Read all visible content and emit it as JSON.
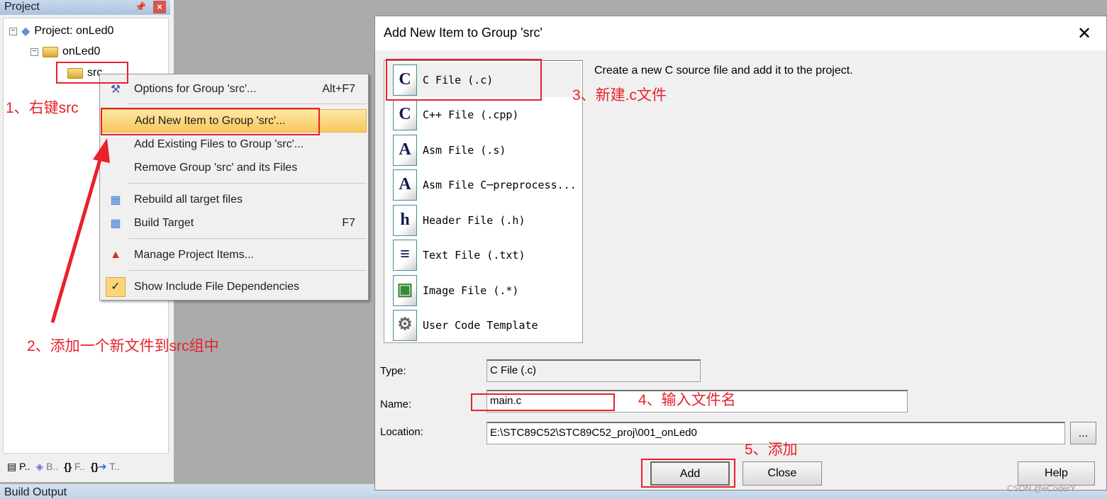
{
  "project_panel": {
    "title": "Project",
    "tree": {
      "root": "Project: onLed0",
      "target": "onLed0",
      "group": "src"
    },
    "tabs": [
      {
        "label": "P..",
        "icon": "project-tab-icon"
      },
      {
        "label": "B..",
        "icon": "books-tab-icon"
      },
      {
        "label": "F..",
        "icon": "functions-tab-icon"
      },
      {
        "label": "T..",
        "icon": "templates-tab-icon"
      }
    ]
  },
  "build_output": {
    "title": "Build Output"
  },
  "context_menu": {
    "items": [
      {
        "label": "Options for Group 'src'...",
        "shortcut": "Alt+F7",
        "icon": "options-wand-icon"
      },
      {
        "label": "Add New  Item to Group 'src'...",
        "shortcut": "",
        "highlighted": true
      },
      {
        "label": "Add Existing Files to Group 'src'...",
        "shortcut": ""
      },
      {
        "label": "Remove Group 'src' and its Files",
        "shortcut": ""
      },
      {
        "label": "Rebuild all target files",
        "shortcut": "",
        "icon": "rebuild-icon"
      },
      {
        "label": "Build Target",
        "shortcut": "F7",
        "icon": "build-icon"
      },
      {
        "label": "Manage Project Items...",
        "shortcut": "",
        "icon": "manage-items-icon"
      },
      {
        "label": "Show Include File Dependencies",
        "shortcut": "",
        "icon": "check-icon",
        "checked": true
      }
    ]
  },
  "dialog": {
    "title": "Add New Item to Group 'src'",
    "description": "Create a new C source file and add it to the project.",
    "file_types": [
      {
        "label": "C File (.c)",
        "glyph": "C",
        "selected": true
      },
      {
        "label": "C++ File (.cpp)",
        "glyph": "C"
      },
      {
        "label": "Asm File (.s)",
        "glyph": "A"
      },
      {
        "label": "Asm File C─preprocess...",
        "glyph": "A"
      },
      {
        "label": "Header File (.h)",
        "glyph": "h"
      },
      {
        "label": "Text File (.txt)",
        "glyph": "≡"
      },
      {
        "label": "Image File (.*)",
        "glyph": "▣"
      },
      {
        "label": "User Code Template",
        "glyph": "⚙"
      }
    ],
    "type_label": "Type:",
    "type_value": "C File (.c)",
    "name_label": "Name:",
    "name_value": "main.c",
    "location_label": "Location:",
    "location_value": "E:\\STC89C52\\STC89C52_proj\\001_onLed0",
    "browse_label": "...",
    "add_label": "Add",
    "close_label": "Close",
    "help_label": "Help"
  },
  "annotations": {
    "a1": "1、右键src",
    "a2": "2、添加一个新文件到src组中",
    "a3": "3、新建.c文件",
    "a4": "4、输入文件名",
    "a5": "5、添加",
    "color": "#e8212b"
  },
  "watermark": "CSDN @eCoderY"
}
